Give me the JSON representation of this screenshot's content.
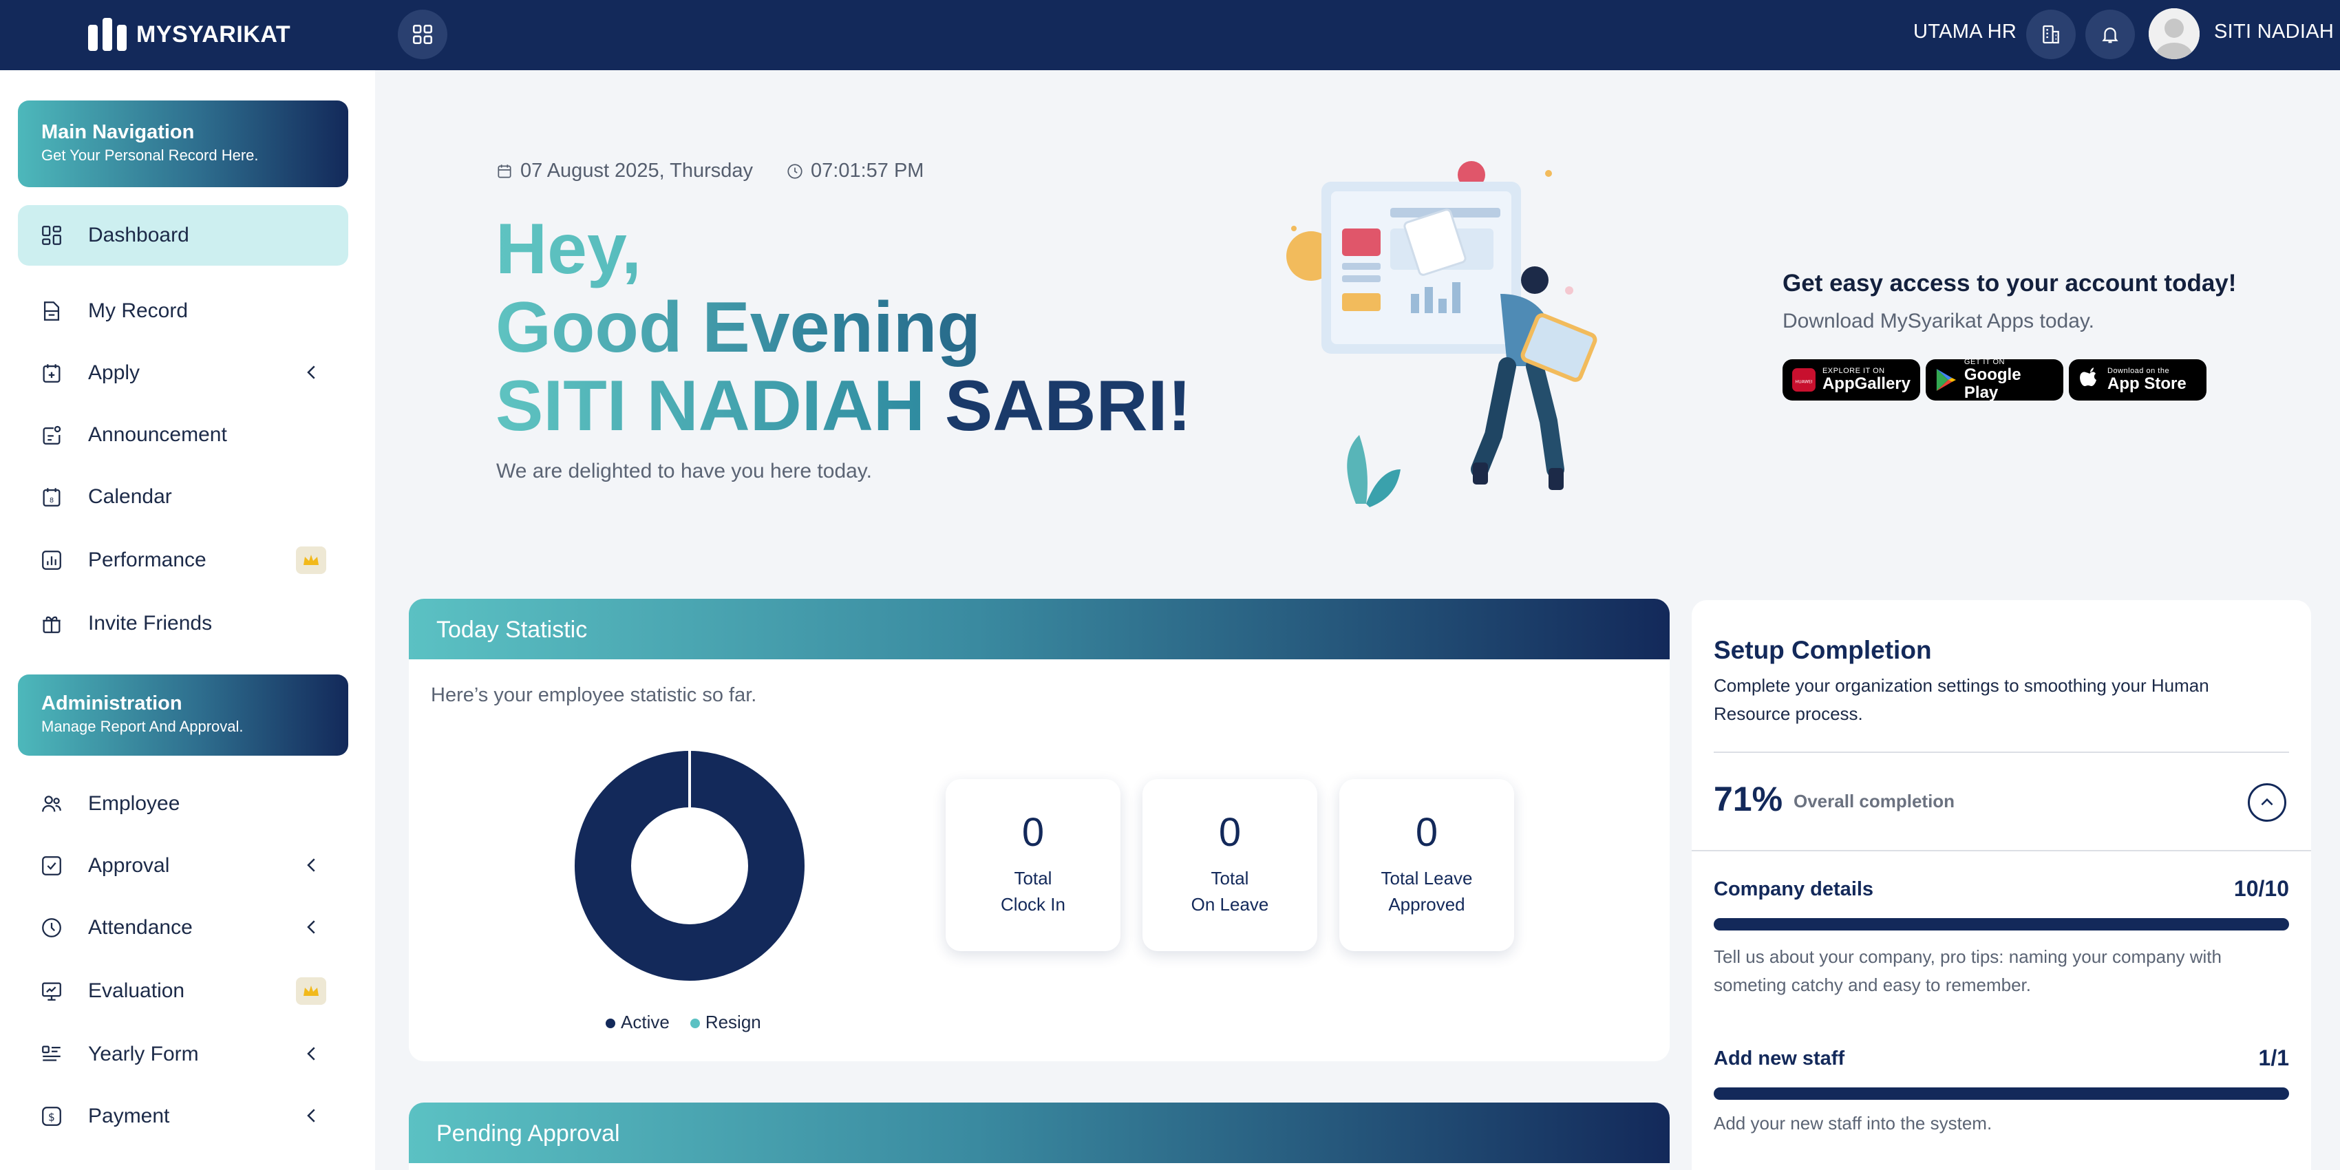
{
  "topbar": {
    "logo_text": "MYSYARIKAT",
    "company": "UTAMA HR",
    "user_name": "SITI NADIAH"
  },
  "sidebar": {
    "main_nav": {
      "title": "Main Navigation",
      "subtitle": "Get Your Personal Record Here."
    },
    "items": [
      {
        "label": "Dashboard",
        "icon": "dashboard-icon",
        "active": true
      },
      {
        "label": "My Record",
        "icon": "record-icon"
      },
      {
        "label": "Apply",
        "icon": "apply-icon",
        "expandable": true
      },
      {
        "label": "Announcement",
        "icon": "announcement-icon"
      },
      {
        "label": "Calendar",
        "icon": "calendar-icon"
      },
      {
        "label": "Performance",
        "icon": "performance-icon",
        "premium": true
      },
      {
        "label": "Invite Friends",
        "icon": "gift-icon"
      }
    ],
    "admin_nav": {
      "title": "Administration",
      "subtitle": "Manage Report And Approval."
    },
    "admin_items": [
      {
        "label": "Employee",
        "icon": "employee-icon"
      },
      {
        "label": "Approval",
        "icon": "approval-icon",
        "expandable": true
      },
      {
        "label": "Attendance",
        "icon": "clock-icon",
        "expandable": true
      },
      {
        "label": "Evaluation",
        "icon": "evaluation-icon",
        "premium": true
      },
      {
        "label": "Yearly Form",
        "icon": "form-icon",
        "expandable": true
      },
      {
        "label": "Payment",
        "icon": "payment-icon",
        "expandable": true
      }
    ]
  },
  "hero": {
    "date": "07 August 2025, Thursday",
    "time": "07:01:57 PM",
    "line1": "Hey,",
    "line2": "Good Evening",
    "name_first": "SITI NADIAH",
    "name_last": "SABRI!",
    "subtitle": "We are delighted to have you here today."
  },
  "download": {
    "title": "Get easy access to your account today!",
    "subtitle": "Download MySyarikat Apps today.",
    "stores": [
      {
        "small": "EXPLORE IT ON",
        "big": "AppGallery"
      },
      {
        "small": "GET IT ON",
        "big": "Google Play"
      },
      {
        "small": "Download on the",
        "big": "App Store"
      }
    ]
  },
  "stats": {
    "title": "Today Statistic",
    "subtitle": "Here’s your employee statistic so far.",
    "legend": [
      {
        "label": "Active",
        "color": "#13295a"
      },
      {
        "label": "Resign",
        "color": "#5bc1c3"
      }
    ],
    "cards": [
      {
        "value": "0",
        "line1": "Total",
        "line2": "Clock In"
      },
      {
        "value": "0",
        "line1": "Total",
        "line2": "On Leave"
      },
      {
        "value": "0",
        "line1": "Total Leave",
        "line2": "Approved"
      }
    ]
  },
  "pending": {
    "title": "Pending Approval"
  },
  "setup": {
    "title": "Setup Completion",
    "description": "Complete your organization settings to smoothing your Human Resource process.",
    "percent": "71%",
    "percent_label": "Overall completion",
    "sections": [
      {
        "title": "Company details",
        "value": "10/10",
        "progress": 1.0,
        "description": "Tell us about your company, pro tips: naming your company with someting catchy and easy to remember."
      },
      {
        "title": "Add new staff",
        "value": "1/1",
        "progress": 1.0,
        "description": "Add your new staff into the system."
      }
    ]
  },
  "colors": {
    "navy": "#13295a",
    "teal": "#5bc1c3",
    "active_bg": "#cdeff0"
  }
}
